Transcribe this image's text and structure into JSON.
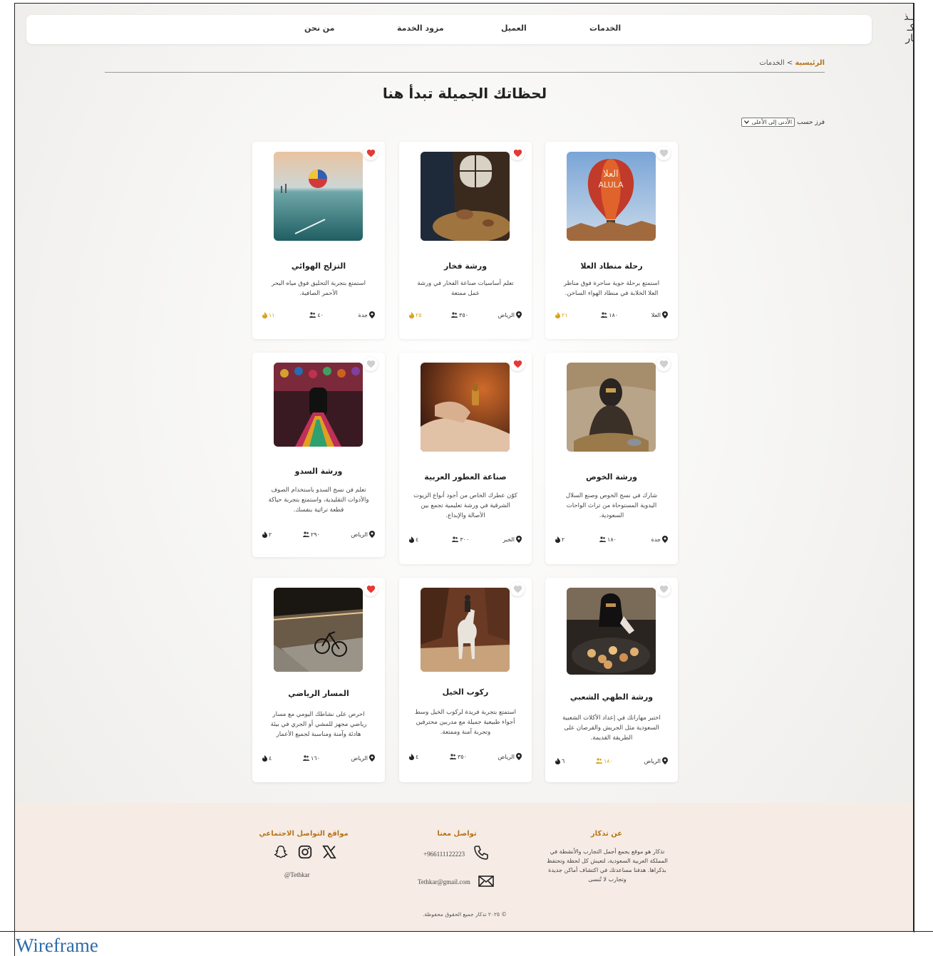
{
  "logo": {
    "line1": "تــذ",
    "line2": "كـ",
    "line3": "ـار"
  },
  "nav": {
    "items": [
      "الخدمات",
      "العميل",
      "مزود الخدمة",
      "من نحن"
    ]
  },
  "breadcrumb": {
    "home": "الرئيسية",
    "sep": ">",
    "current": "الخدمات"
  },
  "page_title": "لحظاتك الجميلة تبدأ هنا",
  "sort": {
    "label": "فرز حسب",
    "selected": "الأدنى إلى الأعلى"
  },
  "cards": [
    {
      "title": "التزلج الهوائي",
      "desc": "استمتع بتجربة التحليق فوق مياه البحر الأحمر الصافية.",
      "location": "جدة",
      "people": "٤٠",
      "hours": "١١",
      "fav": true
    },
    {
      "title": "ورشة فخار",
      "desc": "تعلم أساسيات صناعة الفخار في ورشة عمل ممتعة",
      "location": "الرياض",
      "people": "٣٥٠",
      "hours": "٢٥",
      "fav": true
    },
    {
      "title": "رحلة منطاد العلا",
      "desc": "استمتع برحلة جوية ساحرة فوق مناظر العلا الخلابة في منطاد الهواء الساخن.",
      "location": "العلا",
      "people": "١٨٠",
      "hours": "٢١",
      "fav": false
    },
    {
      "title": "ورشة السدو",
      "desc": "تعلم فن نسج السدو باستخدام الصوف والأدوات التقليدية، واستمتع بتجربة حياكة قطعة تراثية بنفسك.",
      "location": "الرياض",
      "people": "٢٩٠",
      "hours": "٢",
      "fav": false
    },
    {
      "title": "صناعة العطور العربية",
      "desc": "كوّن عطرك الخاص من أجود أنواع الزيوت الشرقية في ورشة تعليمية تجمع بين الأصالة والإبداع.",
      "location": "الخبر",
      "people": "٣٠٠",
      "hours": "٤",
      "fav": true
    },
    {
      "title": "ورشة الخوص",
      "desc": "شارك في نسج الخوص وصنع السلال اليدوية المستوحاة من تراث الواحات السعودية.",
      "location": "جدة",
      "people": "١٨٠",
      "hours": "٢",
      "fav": false
    },
    {
      "title": "المسار الرياضي",
      "desc": "احرص على نشاطك اليومي مع مسار رياضي مجهز للمشي أو الجري في بيئة هادئة وآمنة ومناسبة لجميع الأعمار",
      "location": "الرياض",
      "people": "١٦٠",
      "hours": "٤",
      "fav": true
    },
    {
      "title": "ركوب الخيل",
      "desc": "استمتع بتجربة فريدة لركوب الخيل وسط أجواء طبيعية جميلة مع مدربين محترفين وتجربة آمنة وممتعة.",
      "location": "الرياض",
      "people": "٣٥٠",
      "hours": "٤",
      "fav": false
    },
    {
      "title": "ورشة الطهي الشعبي",
      "desc": "اختبر مهاراتك في إعداد الأكلات الشعبية السعودية مثل الجريش والقرصان على الطريقة القديمة.",
      "location": "الرياض",
      "people": "١٨٠",
      "hours": "٦",
      "fav": false
    }
  ],
  "footer": {
    "about_title": "عن تذكار",
    "about_text": "تذكار هو موقع يجمع أجمل التجارب والأنشطة في المملكة العربية السعودية، لتعيش كل لحظة وتحتفظ بذكراها. هدفنا مساعدتك في اكتشاف أماكن جديدة وتجارب لا تُنسى",
    "contact_title": "تواصل معنا",
    "phone": "+966111122223",
    "email": "Tethkar@gmail.com",
    "social_title": "مواقع التواصل الاجتماعي",
    "handle": "@Tethkar",
    "copyright": "© ٢٠٢٥ تذكار جميع الحقوق محفوظة."
  },
  "wireframe_label": "Wireframe",
  "colors": {
    "accent": "#b8741a",
    "heart_active": "#e53935",
    "heart_inactive": "#cfcfcf",
    "gold": "#d9a21b",
    "footer_bg": "#f6ece5"
  }
}
